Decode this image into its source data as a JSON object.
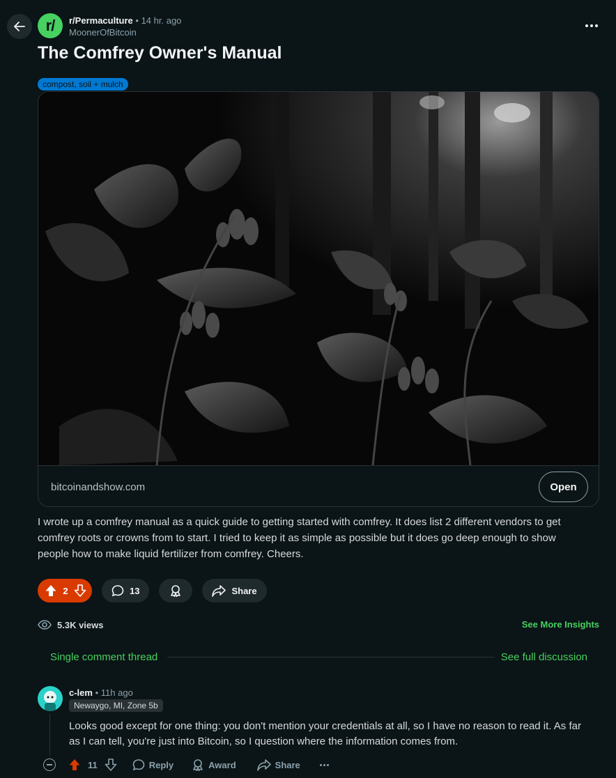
{
  "post": {
    "subreddit": "r/Permaculture",
    "separator": "•",
    "time": "14 hr. ago",
    "author": "MoonerOfBitcoin",
    "title": "The Comfrey Owner's Manual",
    "flair": "compost, soil + mulch",
    "link_domain": "bitcoinandshow.com",
    "open_label": "Open",
    "body": "I wrote up a comfrey manual as a quick guide to getting started with comfrey. It does list 2 different vendors to get comfrey roots or crowns from to start. I tried to keep it as simple as possible but it does go deep enough to show people how to make liquid fertilizer from comfrey. Cheers.",
    "votes": "2",
    "comments": "13",
    "share_label": "Share",
    "views": "5.3K views",
    "insights_label": "See More Insights"
  },
  "thread": {
    "left_label": "Single comment thread",
    "right_label": "See full discussion"
  },
  "comment": {
    "user": "c-lem",
    "separator": "•",
    "time": "11h ago",
    "flair": "Newaygo, MI, Zone 5b",
    "body": "Looks good except for one thing: you don't mention your credentials at all, so I have no reason to read it. As far as I can tell, you're just into Bitcoin, so I question where the information comes from.",
    "votes": "11",
    "reply_label": "Reply",
    "award_label": "Award",
    "share_label": "Share"
  },
  "colors": {
    "background": "#0b1416",
    "accent_green": "#46d160",
    "upvote_orange": "#d93a00",
    "flair_blue": "#0079d3"
  },
  "icons": [
    "back-arrow-icon",
    "more-icon",
    "upvote-icon",
    "downvote-icon",
    "comment-icon",
    "award-icon",
    "share-icon",
    "views-icon",
    "collapse-icon",
    "reply-icon"
  ]
}
